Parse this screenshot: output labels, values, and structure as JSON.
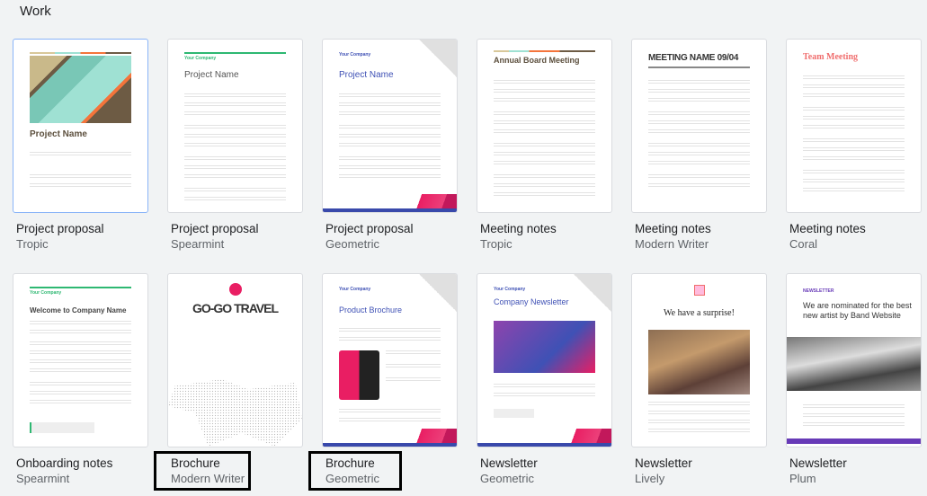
{
  "section": {
    "title": "Work"
  },
  "colors": {
    "accent_selected": "#8ab4f8",
    "spearmint": "#2eb872",
    "geometric_blue": "#3f51b5",
    "geometric_pink": "#e91e63",
    "tropic_orange": "#f4743b",
    "coral": "#f06e6e",
    "plum": "#673ab7"
  },
  "templates": [
    {
      "name": "Project proposal",
      "style": "Tropic",
      "thumb_heading": "Project Name",
      "selected": true
    },
    {
      "name": "Project proposal",
      "style": "Spearmint",
      "thumb_heading": "Project Name",
      "thumb_kicker": "Your Company"
    },
    {
      "name": "Project proposal",
      "style": "Geometric",
      "thumb_heading": "Project Name",
      "thumb_kicker": "Your Company"
    },
    {
      "name": "Meeting notes",
      "style": "Tropic",
      "thumb_heading": "Annual Board Meeting"
    },
    {
      "name": "Meeting notes",
      "style": "Modern Writer",
      "thumb_heading": "MEETING NAME 09/04"
    },
    {
      "name": "Meeting notes",
      "style": "Coral",
      "thumb_heading": "Team Meeting"
    },
    {
      "name": "Onboarding notes",
      "style": "Spearmint",
      "thumb_heading": "Welcome to Company Name",
      "thumb_kicker": "Your Company"
    },
    {
      "name": "Brochure",
      "style": "Modern Writer",
      "thumb_heading": "GO-GO TRAVEL",
      "annotated": true
    },
    {
      "name": "Brochure",
      "style": "Geometric",
      "thumb_heading": "Product Brochure",
      "thumb_kicker": "Your Company",
      "annotated": true
    },
    {
      "name": "Newsletter",
      "style": "Geometric",
      "thumb_heading": "Company Newsletter",
      "thumb_kicker": "Your Company"
    },
    {
      "name": "Newsletter",
      "style": "Lively",
      "thumb_heading": "We have a surprise!"
    },
    {
      "name": "Newsletter",
      "style": "Plum",
      "thumb_heading": "We are nominated for the best new artist by Band Website",
      "thumb_kicker": "NEWSLETTER"
    }
  ]
}
